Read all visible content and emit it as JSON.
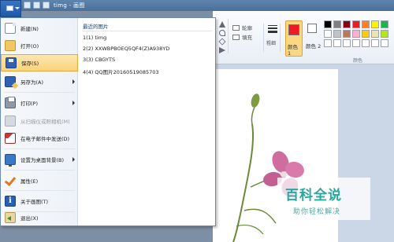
{
  "window": {
    "title": "timg - 画图"
  },
  "menu": {
    "items": [
      {
        "label": "新建(N)"
      },
      {
        "label": "打开(O)"
      },
      {
        "label": "保存(S)"
      },
      {
        "label": "另存为(A)"
      },
      {
        "label": "打印(P)"
      },
      {
        "label": "从扫描仪或照相机(M)"
      },
      {
        "label": "在电子邮件中发送(D)"
      },
      {
        "label": "设置为桌面背景(B)"
      },
      {
        "label": "属性(E)"
      },
      {
        "label": "关于画图(T)"
      },
      {
        "label": "退出(X)"
      }
    ],
    "recent_title": "最近的图片",
    "recent": [
      "1(1)  timg",
      "2(2)  XXWBPBOEQ5QF4(Z)A938YD",
      "3(3)  CBGYTS",
      "4(4)  QQ图片20160519085703"
    ]
  },
  "ribbon": {
    "outline_label": "轮廓",
    "fill_label": "填充",
    "size_label": "粗细",
    "color1_label": "颜色 1",
    "color2_label": "颜色 2",
    "palette_label": "颜色",
    "color1_value": "#ed1c24",
    "color2_value": "#ffffff",
    "palette": [
      "#000000",
      "#7f7f7f",
      "#880015",
      "#ed1c24",
      "#ff7f27",
      "#fff200",
      "#22b14c",
      "#ffffff",
      "#c3c3c3",
      "#b97a57",
      "#ffaec9",
      "#ffc90e",
      "#efe4b0",
      "#b5e61d",
      "#ffffff",
      "#ffffff",
      "#ffffff",
      "#ffffff",
      "#ffffff",
      "#ffffff",
      "#ffffff"
    ]
  },
  "watermark": {
    "title": "百科全说",
    "subtitle": "助你轻松解决"
  }
}
